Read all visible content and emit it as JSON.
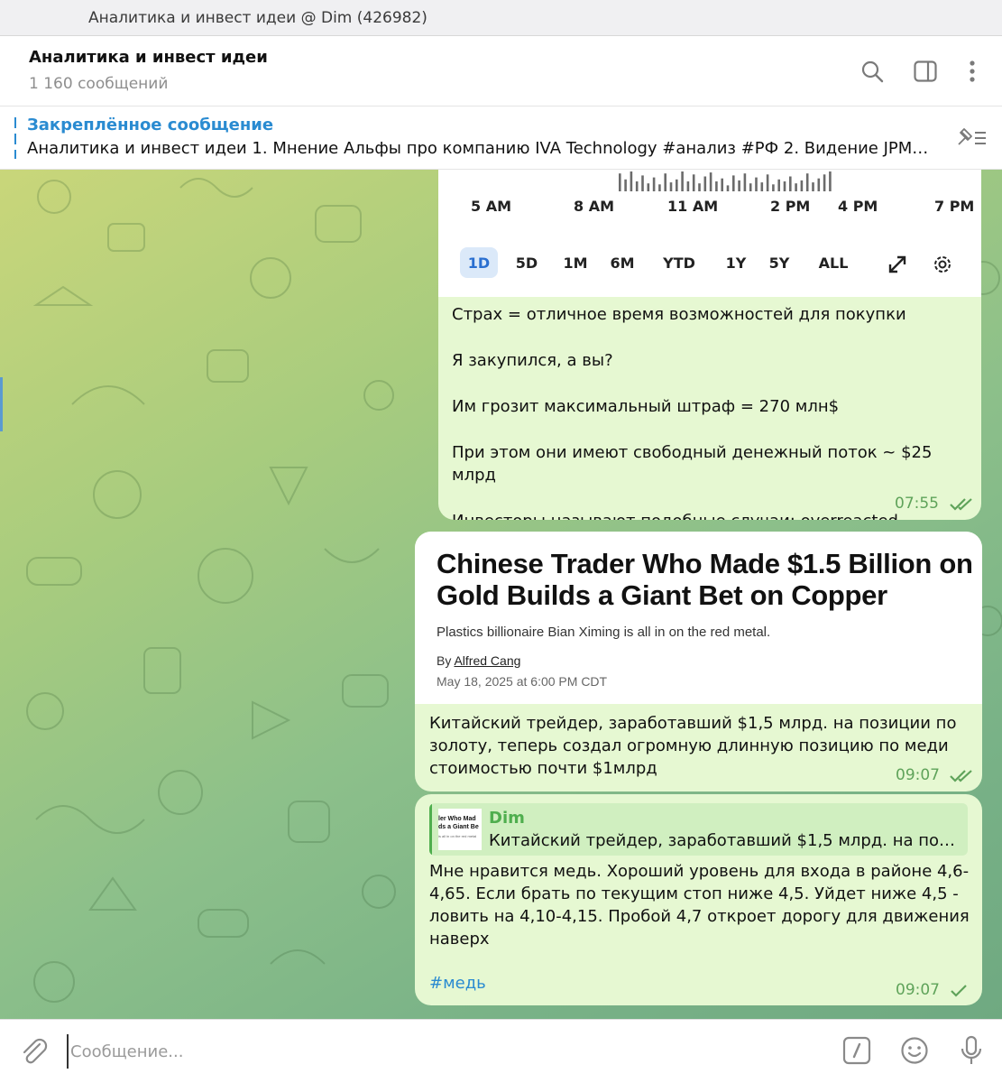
{
  "window": {
    "title": "Аналитика и инвест идеи @ Dim (426982)"
  },
  "header": {
    "title": "Аналитика и инвест идеи",
    "subtitle": "1 160 сообщений",
    "icons": [
      "search-icon",
      "sidebar-toggle-icon",
      "more-vertical-icon"
    ]
  },
  "pinned": {
    "label": "Закреплённое сообщение",
    "text": "Аналитика и инвест идеи   1. Мнение Альфы про компанию IVA Technology  #анализ #РФ 2. Видение JPM на..."
  },
  "messages": [
    {
      "chart": {
        "time_ticks": [
          "5 AM",
          "8 AM",
          "11 AM",
          "2 PM",
          "4 PM",
          "7 PM"
        ],
        "ranges": [
          "1D",
          "5D",
          "1M",
          "6M",
          "YTD",
          "1Y",
          "5Y",
          "ALL"
        ],
        "active_range": "1D",
        "volume_bars": [
          0.9,
          0.6,
          1.0,
          0.5,
          0.8,
          0.4,
          0.7,
          0.35,
          0.9,
          0.45,
          0.6,
          1.0,
          0.5,
          0.85,
          0.4,
          0.75,
          0.95,
          0.5,
          0.65,
          0.3,
          0.8,
          0.55,
          0.9,
          0.4,
          0.7,
          0.45,
          0.85,
          0.35,
          0.6,
          0.5,
          0.75,
          0.4,
          0.55,
          0.9,
          0.45,
          0.65,
          0.85,
          1.0
        ]
      },
      "lines": [
        "Страх = отличное время возможностей для покупки",
        "Я закупился, а вы?",
        "Им грозит максимальный штраф = 270 млн$",
        "При этом они имеют свободный денежный поток ~ $25 млрд",
        "Инвесторы называют подобные случаи: overreacted"
      ],
      "time": "07:55",
      "status": "read"
    },
    {
      "article": {
        "title": "Chinese Trader Who Made $1.5 Billion on Gold Builds a Giant Bet on Copper",
        "subtitle": "Plastics billionaire Bian Ximing is all in on the red metal.",
        "by_prefix": "By",
        "author": "Alfred Cang",
        "date": "May 18, 2025 at 6:00 PM CDT"
      },
      "text": "Китайский трейдер, заработавший $1,5 млрд.  на позиции по золоту, теперь создал огромную длинную позицию по меди стоимостью почти $1млрд",
      "time": "09:07",
      "status": "read"
    },
    {
      "reply": {
        "name": "Dim",
        "text": "Китайский трейдер, заработавший $1,5 млрд.  на пози...",
        "thumb_lines": [
          "ler Who Mad",
          "ds a Giant Be",
          "is all in on the red metal"
        ]
      },
      "text": "Мне нравится медь. Хороший уровень для входа в районе 4,6-4,65. Если брать по текущим стоп ниже 4,5. Уйдет ниже 4,5 - ловить на 4,10-4,15. Пробой 4,7 откроет дорогу для движения наверх",
      "hashtag": "#медь",
      "time": "09:07",
      "status": "sent"
    }
  ],
  "composer": {
    "placeholder": "Сообщение...",
    "icons": [
      "attach-icon",
      "commands-icon",
      "emoji-icon",
      "microphone-icon"
    ]
  },
  "colors": {
    "accent": "#2a8bd1",
    "bubble": "#e6f8d2",
    "time_green": "#5fa35a",
    "reply_green": "#4fae4e"
  }
}
